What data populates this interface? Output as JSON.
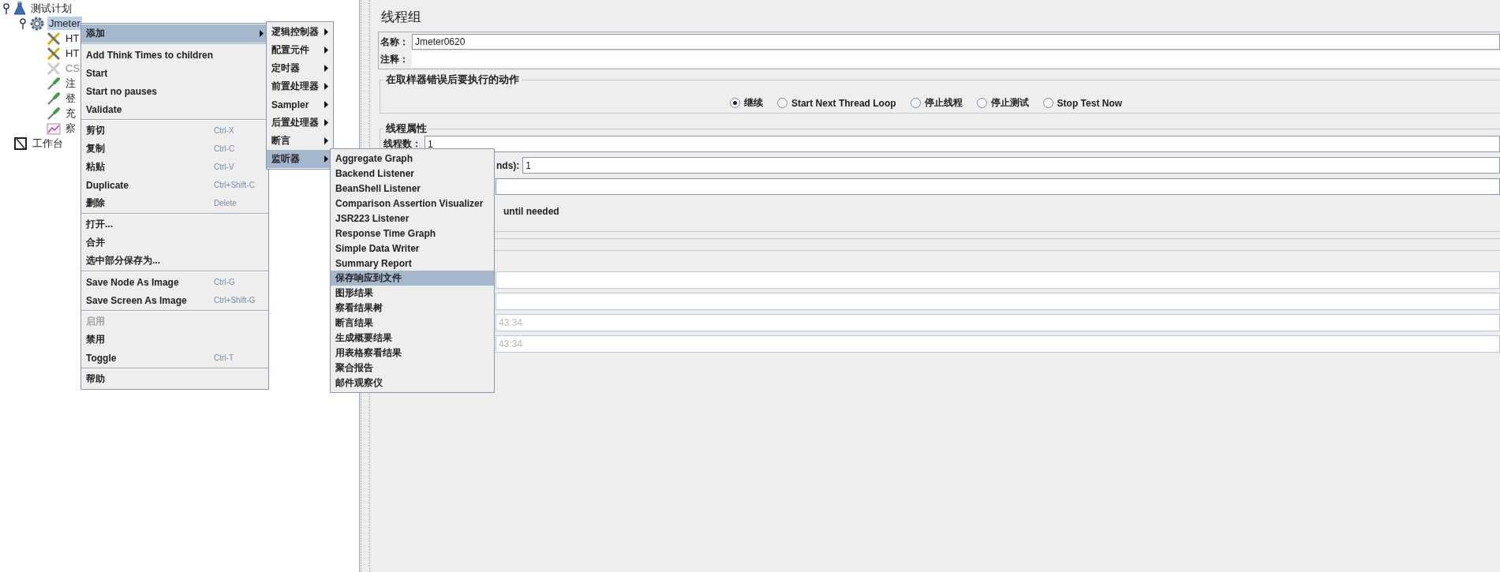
{
  "tree": {
    "items": [
      {
        "label": "测试计划",
        "kind": "plan",
        "selected": false,
        "disabled": false,
        "children": [
          {
            "label": "Jmeter",
            "kind": "threadgroup",
            "selected": true,
            "disabled": false,
            "children": [
              {
                "label": "HT",
                "kind": "sampler",
                "selected": false,
                "disabled": false
              },
              {
                "label": "HT",
                "kind": "sampler",
                "selected": false,
                "disabled": false
              },
              {
                "label": "CS",
                "kind": "sampler",
                "selected": false,
                "disabled": true
              },
              {
                "label": "注",
                "kind": "request",
                "selected": false,
                "disabled": false
              },
              {
                "label": "登",
                "kind": "request",
                "selected": false,
                "disabled": false
              },
              {
                "label": "充",
                "kind": "request",
                "selected": false,
                "disabled": false
              },
              {
                "label": "察",
                "kind": "listener",
                "selected": false,
                "disabled": false
              }
            ]
          }
        ]
      },
      {
        "label": "工作台",
        "kind": "workbench",
        "selected": false,
        "disabled": false
      }
    ]
  },
  "context_menu": {
    "items": [
      {
        "kind": "submenu",
        "label": "添加",
        "selected": true,
        "disabled": false
      },
      {
        "kind": "separator"
      },
      {
        "kind": "item",
        "label": "Add Think Times to children",
        "selected": false,
        "disabled": false
      },
      {
        "kind": "item",
        "label": "Start",
        "selected": false,
        "disabled": false
      },
      {
        "kind": "item",
        "label": "Start no pauses",
        "selected": false,
        "disabled": false
      },
      {
        "kind": "item",
        "label": "Validate",
        "selected": false,
        "disabled": false
      },
      {
        "kind": "separator"
      },
      {
        "kind": "item",
        "label": "剪切",
        "shortcut": "Ctrl-X",
        "selected": false,
        "disabled": false
      },
      {
        "kind": "item",
        "label": "复制",
        "shortcut": "Ctrl-C",
        "selected": false,
        "disabled": false
      },
      {
        "kind": "item",
        "label": "粘贴",
        "shortcut": "Ctrl-V",
        "selected": false,
        "disabled": false
      },
      {
        "kind": "item",
        "label": "Duplicate",
        "shortcut": "Ctrl+Shift-C",
        "selected": false,
        "disabled": false
      },
      {
        "kind": "item",
        "label": "删除",
        "shortcut": "Delete",
        "selected": false,
        "disabled": false
      },
      {
        "kind": "separator"
      },
      {
        "kind": "item",
        "label": "打开...",
        "selected": false,
        "disabled": false
      },
      {
        "kind": "item",
        "label": "合并",
        "selected": false,
        "disabled": false
      },
      {
        "kind": "item",
        "label": "选中部分保存为...",
        "selected": false,
        "disabled": false
      },
      {
        "kind": "separator"
      },
      {
        "kind": "item",
        "label": "Save Node As Image",
        "shortcut": "Ctrl-G",
        "selected": false,
        "disabled": false
      },
      {
        "kind": "item",
        "label": "Save Screen As Image",
        "shortcut": "Ctrl+Shift-G",
        "selected": false,
        "disabled": false
      },
      {
        "kind": "separator"
      },
      {
        "kind": "item",
        "label": "启用",
        "selected": false,
        "disabled": true
      },
      {
        "kind": "item",
        "label": "禁用",
        "selected": false,
        "disabled": false
      },
      {
        "kind": "item",
        "label": "Toggle",
        "shortcut": "Ctrl-T",
        "selected": false,
        "disabled": false
      },
      {
        "kind": "separator"
      },
      {
        "kind": "item",
        "label": "帮助",
        "selected": false,
        "disabled": false
      }
    ]
  },
  "add_submenu": {
    "items": [
      {
        "label": "逻辑控制器",
        "selected": false
      },
      {
        "label": "配置元件",
        "selected": false
      },
      {
        "label": "定时器",
        "selected": false
      },
      {
        "label": "前置处理器",
        "selected": false
      },
      {
        "label": "Sampler",
        "selected": false
      },
      {
        "label": "后置处理器",
        "selected": false
      },
      {
        "label": "断言",
        "selected": false
      },
      {
        "label": "监听器",
        "selected": true
      }
    ]
  },
  "listener_submenu": {
    "items": [
      {
        "label": "Aggregate Graph",
        "selected": false
      },
      {
        "label": "Backend Listener",
        "selected": false
      },
      {
        "label": "BeanShell Listener",
        "selected": false
      },
      {
        "label": "Comparison Assertion Visualizer",
        "selected": false
      },
      {
        "label": "JSR223 Listener",
        "selected": false
      },
      {
        "label": "Response Time Graph",
        "selected": false
      },
      {
        "label": "Simple Data Writer",
        "selected": false
      },
      {
        "label": "Summary Report",
        "selected": false
      },
      {
        "label": "保存响应到文件",
        "selected": true
      },
      {
        "label": "图形结果",
        "selected": false
      },
      {
        "label": "察看结果树",
        "selected": false
      },
      {
        "label": "断言结果",
        "selected": false
      },
      {
        "label": "生成概要结果",
        "selected": false
      },
      {
        "label": "用表格察看结果",
        "selected": false
      },
      {
        "label": "聚合报告",
        "selected": false
      },
      {
        "label": "邮件观察仪",
        "selected": false
      }
    ]
  },
  "panel": {
    "title": "线程组",
    "name_label": "名称：",
    "name_value": "Jmeter0620",
    "comment_label": "注释：",
    "error_group": {
      "title": "在取样器错误后要执行的动作",
      "options": [
        {
          "label": "继续",
          "selected": true
        },
        {
          "label": "Start Next Thread Loop",
          "selected": false
        },
        {
          "label": "停止线程",
          "selected": false
        },
        {
          "label": "停止测试",
          "selected": false
        },
        {
          "label": "Stop Test Now",
          "selected": false
        }
      ]
    },
    "thread_group": {
      "title": "线程属性",
      "rows": [
        {
          "kind": "field",
          "label": "线程数：",
          "value": "1"
        },
        {
          "kind": "field",
          "label": "nds):",
          "value": "1"
        },
        {
          "kind": "field"
        },
        {
          "kind": "note",
          "label": "until needed"
        }
      ]
    },
    "scheduler_fields": [
      {
        "disabled": true
      },
      {
        "disabled": true
      },
      {
        "disabled": true,
        "value": "43:34"
      },
      {
        "disabled": true,
        "value": "43:34"
      }
    ]
  }
}
